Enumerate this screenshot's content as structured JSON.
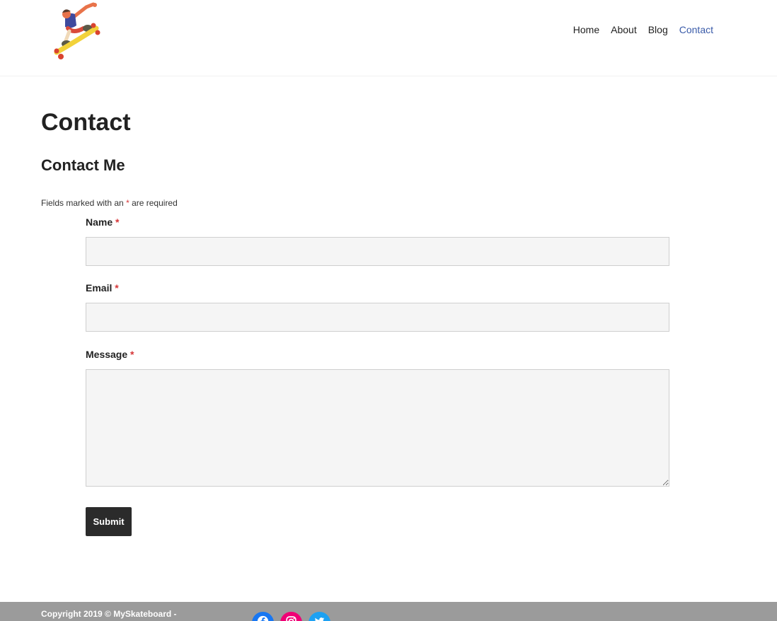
{
  "header": {
    "logo_icon": "skateboarder-illustration",
    "nav": [
      {
        "label": "Home",
        "active": false
      },
      {
        "label": "About",
        "active": false
      },
      {
        "label": "Blog",
        "active": false
      },
      {
        "label": "Contact",
        "active": true
      }
    ],
    "active_nav_color": "#3a5ba9"
  },
  "main": {
    "page_title": "Contact",
    "form_title": "Contact Me",
    "required_note": {
      "prefix": "Fields marked with an",
      "asterisk": "*",
      "suffix": "are required"
    },
    "fields": {
      "name": {
        "label": "Name",
        "required_mark": "*",
        "value": ""
      },
      "email": {
        "label": "Email",
        "required_mark": "*",
        "value": ""
      },
      "message": {
        "label": "Message",
        "required_mark": "*",
        "value": ""
      }
    },
    "submit_label": "Submit"
  },
  "footer": {
    "copyright": "Copyright 2019 © MySkateboard -",
    "social": [
      {
        "icon": "facebook-icon",
        "color": "#1877f2"
      },
      {
        "icon": "instagram-icon",
        "color": "#f00075"
      },
      {
        "icon": "twitter-icon",
        "color": "#1da1f2"
      }
    ],
    "background": "#9b9b9b"
  }
}
